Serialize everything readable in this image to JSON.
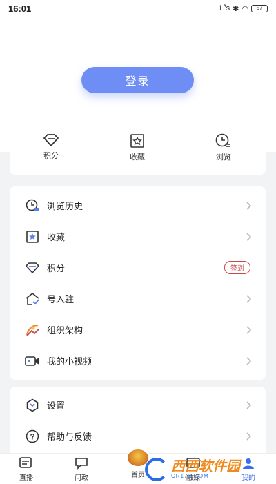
{
  "status": {
    "time": "16:01",
    "signal_text": "1.̊'s",
    "battery": "57"
  },
  "login": {
    "label": "登录"
  },
  "quick": [
    {
      "label": "积分",
      "icon": "diamond-icon"
    },
    {
      "label": "收藏",
      "icon": "star-bookmark-icon"
    },
    {
      "label": "浏览",
      "icon": "clock-icon"
    }
  ],
  "menu": [
    {
      "label": "浏览历史",
      "icon": "history-icon"
    },
    {
      "label": "收藏",
      "icon": "star-bookmark-icon"
    },
    {
      "label": "积分",
      "icon": "diamond-icon",
      "badge": "签到"
    },
    {
      "label": "号入驻",
      "icon": "house-check-icon"
    },
    {
      "label": "组织架构",
      "icon": "org-chart-icon"
    },
    {
      "label": "我的小视频",
      "icon": "video-icon"
    }
  ],
  "settings": [
    {
      "label": "设置",
      "icon": "settings-icon"
    },
    {
      "label": "帮助与反馈",
      "icon": "help-icon"
    }
  ],
  "tabs": [
    {
      "label": "直播",
      "icon": "live-icon"
    },
    {
      "label": "问政",
      "icon": "question-chat-icon"
    },
    {
      "label": "首页",
      "icon": "home-emblem-icon"
    },
    {
      "label": "融媒",
      "icon": "media-icon"
    },
    {
      "label": "我的",
      "icon": "profile-icon"
    }
  ],
  "watermark": {
    "text": "西西软件园",
    "sub": "CR173.COM"
  },
  "colors": {
    "accent": "#6e8ef5",
    "badge_red": "#c74a4a",
    "tab_active": "#3a6ee8"
  }
}
